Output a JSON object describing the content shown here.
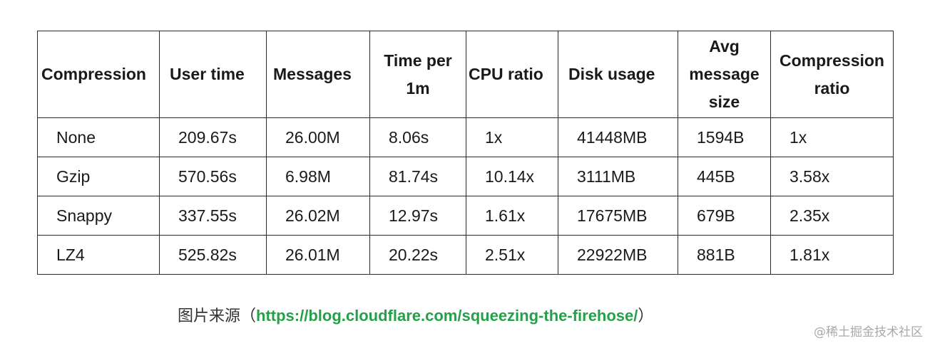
{
  "table": {
    "headers": [
      [
        "Compression"
      ],
      [
        "User time"
      ],
      [
        "Messages"
      ],
      [
        "Time per",
        "1m"
      ],
      [
        "CPU ratio"
      ],
      [
        "Disk usage"
      ],
      [
        "Avg",
        "message",
        "size"
      ],
      [
        "Compression",
        "ratio"
      ]
    ],
    "rows": [
      [
        "None",
        "209.67s",
        "26.00M",
        "8.06s",
        "1x",
        "41448MB",
        "1594B",
        "1x"
      ],
      [
        "Gzip",
        "570.56s",
        "6.98M",
        "81.74s",
        "10.14x",
        "3111MB",
        "445B",
        "3.58x"
      ],
      [
        "Snappy",
        "337.55s",
        "26.02M",
        "12.97s",
        "1.61x",
        "17675MB",
        "679B",
        "2.35x"
      ],
      [
        "LZ4",
        "525.82s",
        "26.01M",
        "20.22s",
        "2.51x",
        "22922MB",
        "881B",
        "1.81x"
      ]
    ]
  },
  "caption": {
    "prefix": "图片来源（",
    "link": "https://blog.cloudflare.com/squeezing-the-firehose/",
    "suffix": "）"
  },
  "watermark": "@稀土掘金技术社区",
  "colors": {
    "link": "#24a148",
    "border": "#2a2a2a",
    "watermark": "#a9a9a9"
  }
}
